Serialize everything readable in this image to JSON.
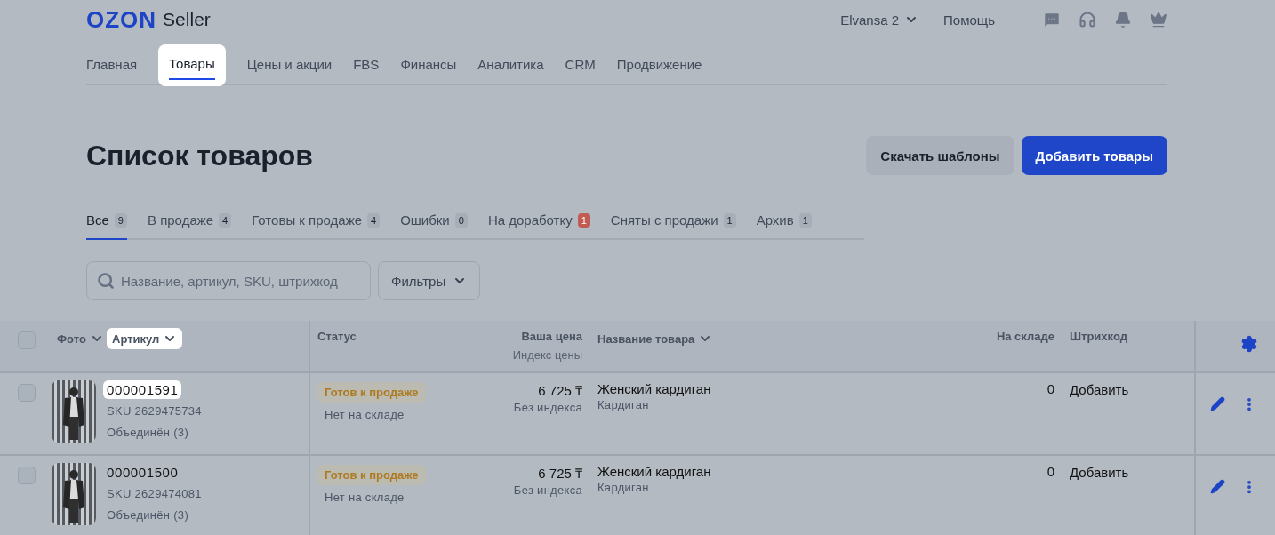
{
  "header": {
    "logo": "OZON",
    "logo_suffix": "Seller",
    "account": "Elvansa 2",
    "help": "Помощь"
  },
  "nav": [
    {
      "label": "Главная",
      "selected": false,
      "highlighted": false
    },
    {
      "label": "Товары",
      "selected": true,
      "highlighted": true
    },
    {
      "label": "Цены и акции",
      "selected": false,
      "highlighted": false
    },
    {
      "label": "FBS",
      "selected": false,
      "highlighted": false
    },
    {
      "label": "Финансы",
      "selected": false,
      "highlighted": false
    },
    {
      "label": "Аналитика",
      "selected": false,
      "highlighted": false
    },
    {
      "label": "CRM",
      "selected": false,
      "highlighted": false
    },
    {
      "label": "Продвижение",
      "selected": false,
      "highlighted": false
    }
  ],
  "page_title": "Список товаров",
  "actions": [
    {
      "label": "Скачать шаблоны",
      "kind": "secondary"
    },
    {
      "label": "Добавить товары",
      "kind": "primary"
    }
  ],
  "status_tabs": [
    {
      "label": "Все",
      "count": "9",
      "selected": true,
      "alert": false
    },
    {
      "label": "В продаже",
      "count": "4",
      "selected": false,
      "alert": false
    },
    {
      "label": "Готовы к продаже",
      "count": "4",
      "selected": false,
      "alert": false
    },
    {
      "label": "Ошибки",
      "count": "0",
      "selected": false,
      "alert": false
    },
    {
      "label": "На доработку",
      "count": "1",
      "selected": false,
      "alert": true
    },
    {
      "label": "Сняты с продажи",
      "count": "1",
      "selected": false,
      "alert": false
    },
    {
      "label": "Архив",
      "count": "1",
      "selected": false,
      "alert": false
    }
  ],
  "search": {
    "placeholder": "Название, артикул, SKU, штрихкод"
  },
  "filter_button": "Фильтры",
  "table": {
    "header": {
      "select_all_checked": false,
      "photo": "Фото",
      "article": "Артикул",
      "article_highlighted": true,
      "status": "Статус",
      "price": "Ваша цена",
      "price_index": "Индекс цены",
      "name": "Название товара",
      "stock": "На складе",
      "barcode": "Штрихкод"
    },
    "rows": [
      {
        "checked": false,
        "article": "000001591",
        "article_highlighted": true,
        "sku": "SKU 2629475734",
        "merged": "Объединён (3)",
        "status": "Готов к продаже",
        "stock_note": "Нет на складе",
        "price": "6 725 ₸",
        "price_index": "Без индекса",
        "name": "Женский кардиган",
        "category": "Кардиган",
        "stock": "0",
        "barcode": "Добавить"
      },
      {
        "checked": false,
        "article": "000001500",
        "article_highlighted": false,
        "sku": "SKU 2629474081",
        "merged": "Объединён (3)",
        "status": "Готов к продаже",
        "stock_note": "Нет на складе",
        "price": "6 725 ₸",
        "price_index": "Без индекса",
        "name": "Женский кардиган",
        "category": "Кардиган",
        "stock": "0",
        "barcode": "Добавить"
      }
    ]
  }
}
